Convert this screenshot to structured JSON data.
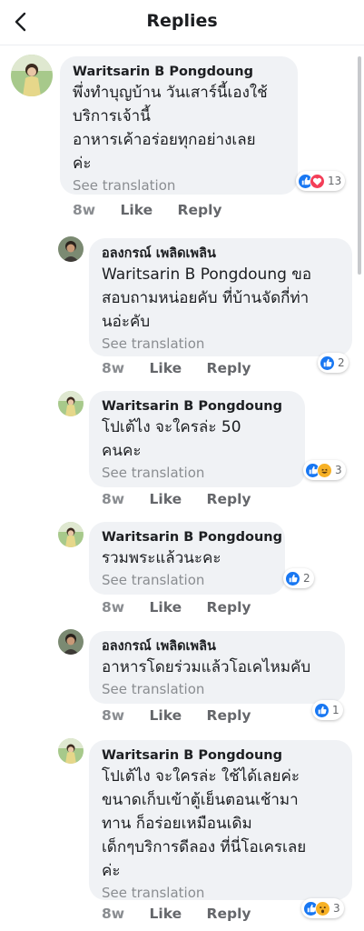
{
  "header": {
    "title": "Replies"
  },
  "comments": [
    {
      "name": "Waritsarin B Pongdoung",
      "text": "พึ่งทำบุญบ้าน วันเสาร์นี้เองใช้\nบริการเจ้านี้\nอาหารเค้าอร่อยทุกอย่างเลย\nค่ะ",
      "see": "See translation",
      "count": "13",
      "time": "8w",
      "like": "Like",
      "reply": "Reply"
    },
    {
      "name": "อลงกรณ์ เพลิดเพลิน",
      "text": "Waritsarin B Pongdoung ขอ\nสอบถามหน่อยคับ ที่บ้านจัดกี่ท่า\nนอ่ะคับ",
      "see": "See translation",
      "count": "2",
      "time": "8w",
      "like": "Like",
      "reply": "Reply"
    },
    {
      "name": "Waritsarin B Pongdoung",
      "text": "โปเต้ไง จะใครล่ะ 50\nคนคะ",
      "see": "See translation",
      "count": "3",
      "time": "8w",
      "like": "Like",
      "reply": "Reply"
    },
    {
      "name": "Waritsarin B Pongdoung",
      "text": "รวมพระแล้วนะคะ",
      "see": "See translation",
      "count": "2",
      "time": "8w",
      "like": "Like",
      "reply": "Reply"
    },
    {
      "name": "อลงกรณ์ เพลิดเพลิน",
      "text": "อาหารโดยร่วมแล้วโอเคไหมคับ",
      "see": "See translation",
      "count": "1",
      "time": "8w",
      "like": "Like",
      "reply": "Reply"
    },
    {
      "name": "Waritsarin B Pongdoung",
      "text": "โปเต้ไง จะใครล่ะ ใช้ได้เลยค่ะ\nขนาดเก็บเข้าตู้เย็นตอนเช้ามา\nทาน ก็อร่อยเหมือนเดิม\nเด็กๆบริการดีลอง  ที่นี่โอเครเลย\nค่ะ",
      "see": "See translation",
      "count": "3",
      "time": "8w",
      "like": "Like",
      "reply": "Reply"
    }
  ],
  "icons": {
    "back": "chevron-left-icon",
    "like_reaction": "thumbs-up-icon",
    "love_reaction": "heart-icon",
    "haha_reaction": "laughing-face-icon",
    "wow_reaction": "surprised-face-icon"
  },
  "colors": {
    "like_blue": "#1877f2",
    "love_red": "#f33e58",
    "emoji_yellow": "#f7b125",
    "bubble_bg": "#f0f2f5",
    "meta_gray": "#65676b"
  }
}
